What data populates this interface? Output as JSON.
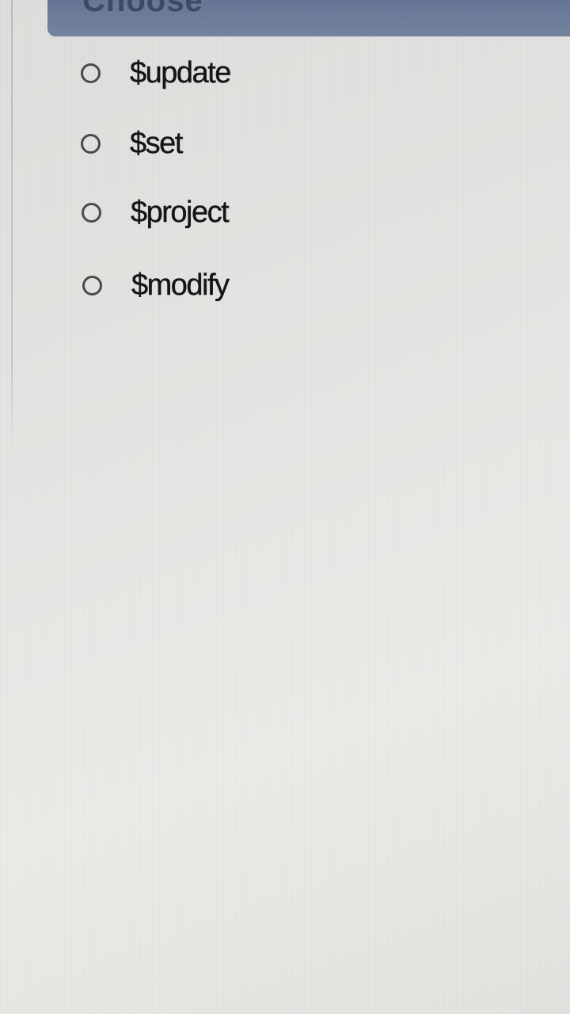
{
  "question": {
    "header_text": "Choose",
    "options": [
      {
        "label": "$update",
        "selected": false
      },
      {
        "label": "$set",
        "selected": false
      },
      {
        "label": "$project",
        "selected": false
      },
      {
        "label": "$modify",
        "selected": false
      }
    ]
  },
  "colors": {
    "header_bar": "#6a7995",
    "background": "#e6e7e4",
    "text": "#161616",
    "radio_border": "#4b4b4b"
  }
}
